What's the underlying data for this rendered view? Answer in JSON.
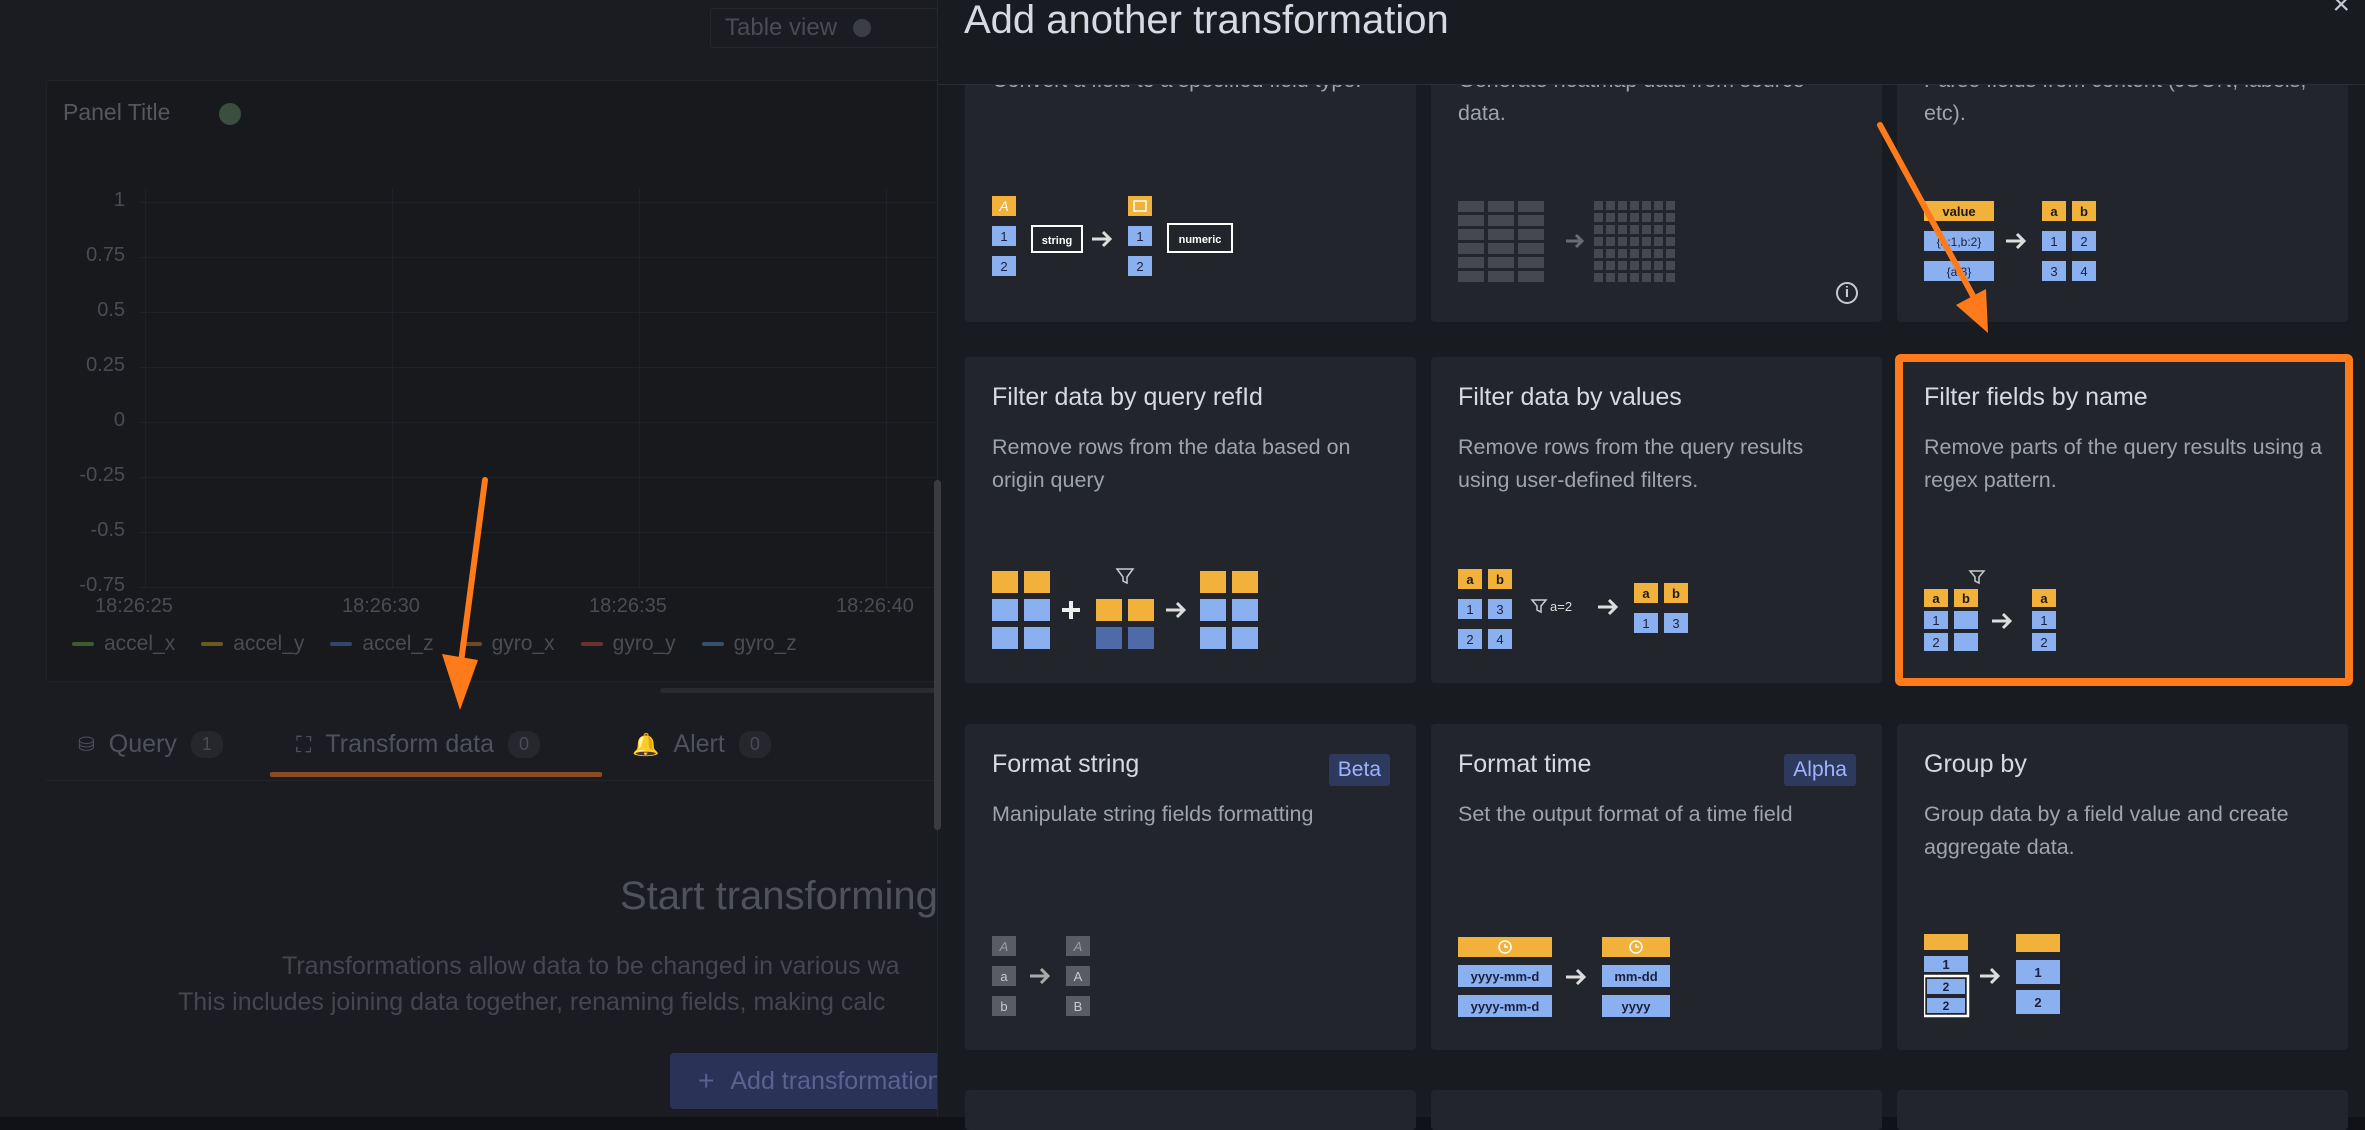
{
  "background": {
    "table_view_label": "Table view",
    "panel_title": "Panel Title",
    "y_ticks": [
      "1",
      "0.75",
      "0.5",
      "0.25",
      "0",
      "-0.25",
      "-0.5",
      "-0.75"
    ],
    "x_ticks": [
      "18:26:25",
      "18:26:30",
      "18:26:35",
      "18:26:40"
    ],
    "legend": [
      {
        "label": "accel_x",
        "color": "#3d5a33"
      },
      {
        "label": "accel_y",
        "color": "#6b5a1e"
      },
      {
        "label": "accel_z",
        "color": "#34456b"
      },
      {
        "label": "gyro_x",
        "color": "#6b4a26"
      },
      {
        "label": "gyro_y",
        "color": "#6b3030"
      },
      {
        "label": "gyro_z",
        "color": "#34506b"
      }
    ],
    "tabs": [
      {
        "label": "Query",
        "count": "1"
      },
      {
        "label": "Transform data",
        "count": "0"
      },
      {
        "label": "Alert",
        "count": "0"
      }
    ],
    "empty_title": "Start transforming",
    "empty_desc_1": "Transformations allow data to be changed in various wa",
    "empty_desc_2": "This includes joining data together, renaming fields, making calc",
    "add_button": "Add transformation"
  },
  "drawer": {
    "title": "Add another transformation",
    "close_glyph": "×",
    "cards": [
      {
        "title": "",
        "description": "Convert a field to a specified field type.",
        "badge": ""
      },
      {
        "title": "",
        "description": "Generate heatmap data from source data.",
        "badge": ""
      },
      {
        "title": "",
        "description": "Parse fields from content (JSON, labels, etc).",
        "badge": ""
      },
      {
        "title": "Filter data by query refId",
        "description": "Remove rows from the data based on origin query",
        "badge": ""
      },
      {
        "title": "Filter data by values",
        "description": "Remove rows from the query results using user-defined filters.",
        "badge": ""
      },
      {
        "title": "Filter fields by name",
        "description": "Remove parts of the query results using a regex pattern.",
        "badge": ""
      },
      {
        "title": "Format string",
        "description": "Manipulate string fields formatting",
        "badge": "Beta"
      },
      {
        "title": "Format time",
        "description": "Set the output format of a time field",
        "badge": "Alpha"
      },
      {
        "title": "Group by",
        "description": "Group data by a field value and create aggregate data.",
        "badge": ""
      }
    ]
  },
  "illustrations": {
    "convert_a": "A",
    "convert_string": "string",
    "convert_numeric": "numeric",
    "convert_one": "1",
    "convert_two": "2",
    "extract_value": "value",
    "extract_row1": "{a:1,b:2}",
    "extract_row2": "{a:3}",
    "a": "a",
    "b": "b",
    "v1": "1",
    "v2": "2",
    "v3": "3",
    "v4": "4",
    "filter_cond": "a=2",
    "fmt_a": "A",
    "fmt_big_a": "A",
    "fmt_big_b": "B",
    "time_in": "yyyy-mm-d",
    "time_out1": "mm-dd",
    "time_out2": "yyyy"
  },
  "colors": {
    "highlight": "#ff7a1a",
    "yellow": "#f2b13a",
    "blue": "#8ab0f0"
  }
}
